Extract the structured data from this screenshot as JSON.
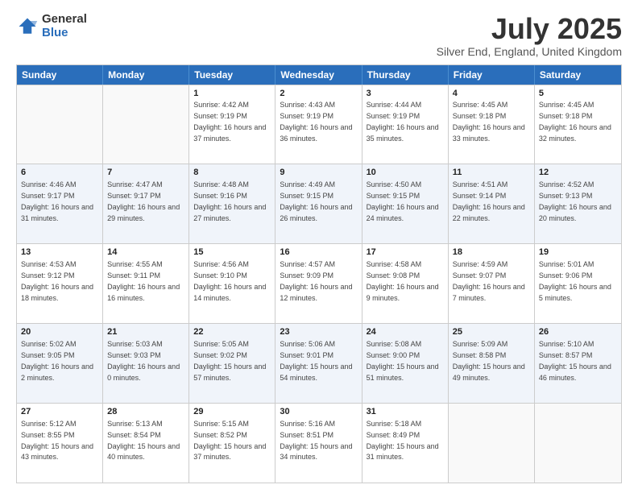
{
  "logo": {
    "general": "General",
    "blue": "Blue"
  },
  "title": "July 2025",
  "location": "Silver End, England, United Kingdom",
  "headers": [
    "Sunday",
    "Monday",
    "Tuesday",
    "Wednesday",
    "Thursday",
    "Friday",
    "Saturday"
  ],
  "weeks": [
    [
      {
        "day": "",
        "sunrise": "",
        "sunset": "",
        "daylight": ""
      },
      {
        "day": "",
        "sunrise": "",
        "sunset": "",
        "daylight": ""
      },
      {
        "day": "1",
        "sunrise": "Sunrise: 4:42 AM",
        "sunset": "Sunset: 9:19 PM",
        "daylight": "Daylight: 16 hours and 37 minutes."
      },
      {
        "day": "2",
        "sunrise": "Sunrise: 4:43 AM",
        "sunset": "Sunset: 9:19 PM",
        "daylight": "Daylight: 16 hours and 36 minutes."
      },
      {
        "day": "3",
        "sunrise": "Sunrise: 4:44 AM",
        "sunset": "Sunset: 9:19 PM",
        "daylight": "Daylight: 16 hours and 35 minutes."
      },
      {
        "day": "4",
        "sunrise": "Sunrise: 4:45 AM",
        "sunset": "Sunset: 9:18 PM",
        "daylight": "Daylight: 16 hours and 33 minutes."
      },
      {
        "day": "5",
        "sunrise": "Sunrise: 4:45 AM",
        "sunset": "Sunset: 9:18 PM",
        "daylight": "Daylight: 16 hours and 32 minutes."
      }
    ],
    [
      {
        "day": "6",
        "sunrise": "Sunrise: 4:46 AM",
        "sunset": "Sunset: 9:17 PM",
        "daylight": "Daylight: 16 hours and 31 minutes."
      },
      {
        "day": "7",
        "sunrise": "Sunrise: 4:47 AM",
        "sunset": "Sunset: 9:17 PM",
        "daylight": "Daylight: 16 hours and 29 minutes."
      },
      {
        "day": "8",
        "sunrise": "Sunrise: 4:48 AM",
        "sunset": "Sunset: 9:16 PM",
        "daylight": "Daylight: 16 hours and 27 minutes."
      },
      {
        "day": "9",
        "sunrise": "Sunrise: 4:49 AM",
        "sunset": "Sunset: 9:15 PM",
        "daylight": "Daylight: 16 hours and 26 minutes."
      },
      {
        "day": "10",
        "sunrise": "Sunrise: 4:50 AM",
        "sunset": "Sunset: 9:15 PM",
        "daylight": "Daylight: 16 hours and 24 minutes."
      },
      {
        "day": "11",
        "sunrise": "Sunrise: 4:51 AM",
        "sunset": "Sunset: 9:14 PM",
        "daylight": "Daylight: 16 hours and 22 minutes."
      },
      {
        "day": "12",
        "sunrise": "Sunrise: 4:52 AM",
        "sunset": "Sunset: 9:13 PM",
        "daylight": "Daylight: 16 hours and 20 minutes."
      }
    ],
    [
      {
        "day": "13",
        "sunrise": "Sunrise: 4:53 AM",
        "sunset": "Sunset: 9:12 PM",
        "daylight": "Daylight: 16 hours and 18 minutes."
      },
      {
        "day": "14",
        "sunrise": "Sunrise: 4:55 AM",
        "sunset": "Sunset: 9:11 PM",
        "daylight": "Daylight: 16 hours and 16 minutes."
      },
      {
        "day": "15",
        "sunrise": "Sunrise: 4:56 AM",
        "sunset": "Sunset: 9:10 PM",
        "daylight": "Daylight: 16 hours and 14 minutes."
      },
      {
        "day": "16",
        "sunrise": "Sunrise: 4:57 AM",
        "sunset": "Sunset: 9:09 PM",
        "daylight": "Daylight: 16 hours and 12 minutes."
      },
      {
        "day": "17",
        "sunrise": "Sunrise: 4:58 AM",
        "sunset": "Sunset: 9:08 PM",
        "daylight": "Daylight: 16 hours and 9 minutes."
      },
      {
        "day": "18",
        "sunrise": "Sunrise: 4:59 AM",
        "sunset": "Sunset: 9:07 PM",
        "daylight": "Daylight: 16 hours and 7 minutes."
      },
      {
        "day": "19",
        "sunrise": "Sunrise: 5:01 AM",
        "sunset": "Sunset: 9:06 PM",
        "daylight": "Daylight: 16 hours and 5 minutes."
      }
    ],
    [
      {
        "day": "20",
        "sunrise": "Sunrise: 5:02 AM",
        "sunset": "Sunset: 9:05 PM",
        "daylight": "Daylight: 16 hours and 2 minutes."
      },
      {
        "day": "21",
        "sunrise": "Sunrise: 5:03 AM",
        "sunset": "Sunset: 9:03 PM",
        "daylight": "Daylight: 16 hours and 0 minutes."
      },
      {
        "day": "22",
        "sunrise": "Sunrise: 5:05 AM",
        "sunset": "Sunset: 9:02 PM",
        "daylight": "Daylight: 15 hours and 57 minutes."
      },
      {
        "day": "23",
        "sunrise": "Sunrise: 5:06 AM",
        "sunset": "Sunset: 9:01 PM",
        "daylight": "Daylight: 15 hours and 54 minutes."
      },
      {
        "day": "24",
        "sunrise": "Sunrise: 5:08 AM",
        "sunset": "Sunset: 9:00 PM",
        "daylight": "Daylight: 15 hours and 51 minutes."
      },
      {
        "day": "25",
        "sunrise": "Sunrise: 5:09 AM",
        "sunset": "Sunset: 8:58 PM",
        "daylight": "Daylight: 15 hours and 49 minutes."
      },
      {
        "day": "26",
        "sunrise": "Sunrise: 5:10 AM",
        "sunset": "Sunset: 8:57 PM",
        "daylight": "Daylight: 15 hours and 46 minutes."
      }
    ],
    [
      {
        "day": "27",
        "sunrise": "Sunrise: 5:12 AM",
        "sunset": "Sunset: 8:55 PM",
        "daylight": "Daylight: 15 hours and 43 minutes."
      },
      {
        "day": "28",
        "sunrise": "Sunrise: 5:13 AM",
        "sunset": "Sunset: 8:54 PM",
        "daylight": "Daylight: 15 hours and 40 minutes."
      },
      {
        "day": "29",
        "sunrise": "Sunrise: 5:15 AM",
        "sunset": "Sunset: 8:52 PM",
        "daylight": "Daylight: 15 hours and 37 minutes."
      },
      {
        "day": "30",
        "sunrise": "Sunrise: 5:16 AM",
        "sunset": "Sunset: 8:51 PM",
        "daylight": "Daylight: 15 hours and 34 minutes."
      },
      {
        "day": "31",
        "sunrise": "Sunrise: 5:18 AM",
        "sunset": "Sunset: 8:49 PM",
        "daylight": "Daylight: 15 hours and 31 minutes."
      },
      {
        "day": "",
        "sunrise": "",
        "sunset": "",
        "daylight": ""
      },
      {
        "day": "",
        "sunrise": "",
        "sunset": "",
        "daylight": ""
      }
    ]
  ]
}
